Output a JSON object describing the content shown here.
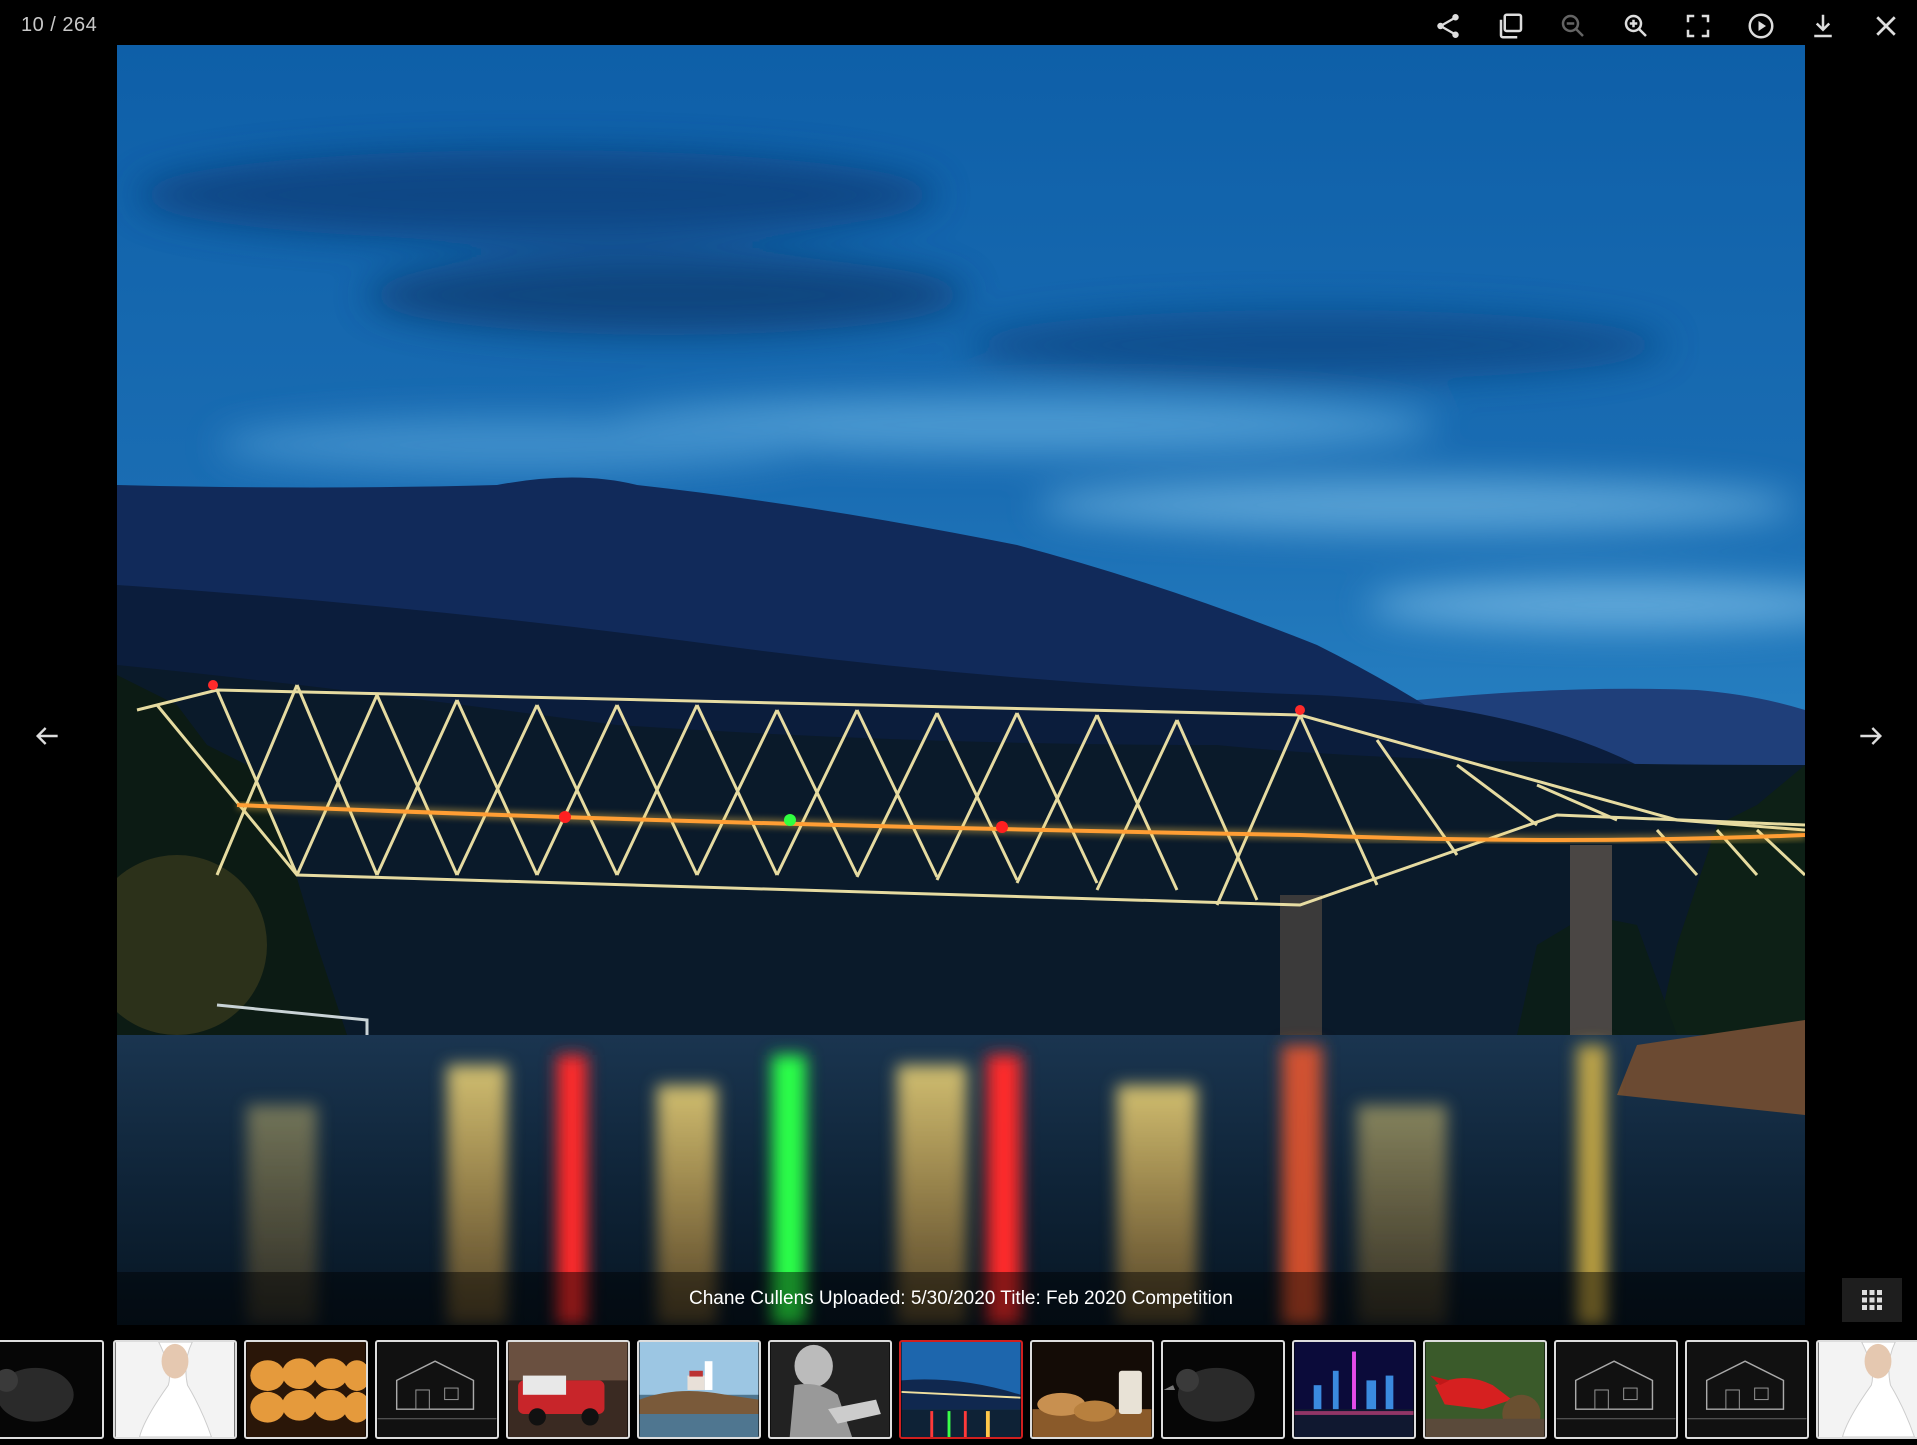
{
  "counter": "10 / 264",
  "toolbar": {
    "share": "share-icon",
    "copy": "copy-icon",
    "zoom_out": "zoom-out-icon",
    "zoom_in": "zoom-in-icon",
    "fullscreen": "fullscreen-icon",
    "play": "play-icon",
    "download": "download-icon",
    "close": "close-icon"
  },
  "caption": "Chane Cullens Uploaded: 5/30/2020 Title: Feb 2020 Competition",
  "nav": {
    "prev": "arrow-left-icon",
    "next": "arrow-right-icon"
  },
  "grid_toggle": "grid-icon",
  "colors": {
    "background": "#000000",
    "active_thumb_border": "#d01f1f",
    "thumb_border": "#dddddd"
  },
  "thumbnails": [
    {
      "subject": "black bird",
      "active": false
    },
    {
      "subject": "woman in white dress",
      "active": false
    },
    {
      "subject": "bread rolls",
      "active": false
    },
    {
      "subject": "house sketch",
      "active": false
    },
    {
      "subject": "red truck",
      "active": false
    },
    {
      "subject": "lighthouse",
      "active": false
    },
    {
      "subject": "black and white portrait",
      "active": false
    },
    {
      "subject": "bridge at night",
      "active": true
    },
    {
      "subject": "cookies and milk",
      "active": false
    },
    {
      "subject": "black bird",
      "active": false
    },
    {
      "subject": "city skyline at night",
      "active": false
    },
    {
      "subject": "red cardinal",
      "active": false
    },
    {
      "subject": "house sketch",
      "active": false
    },
    {
      "subject": "house sketch",
      "active": false
    },
    {
      "subject": "woman in white dress",
      "active": false
    }
  ]
}
